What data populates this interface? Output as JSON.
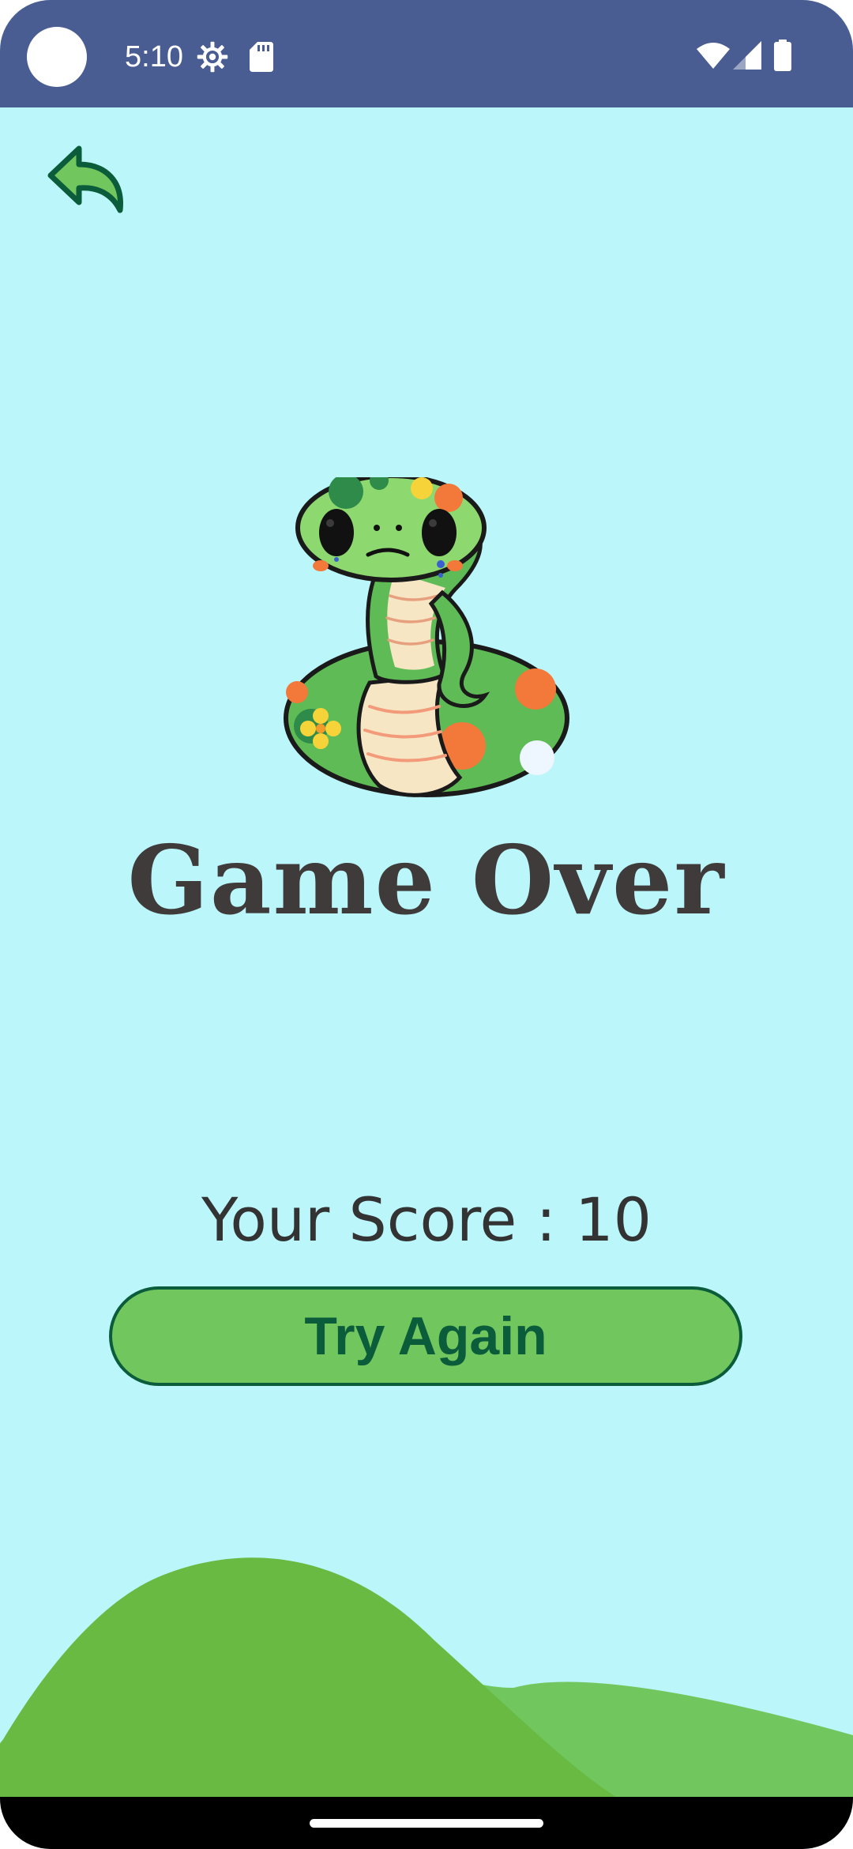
{
  "status_bar": {
    "time": "5:10",
    "background_color": "#4a5d93",
    "icons": [
      "settings-icon",
      "sd-card-icon",
      "wifi-icon",
      "cellular-signal-icon",
      "battery-icon"
    ]
  },
  "screen": {
    "background_color": "#bbf6fa",
    "back_icon": "back-reply-arrow-icon",
    "illustration": "sad-snake-illustration",
    "title": "Game Over",
    "score_text": "Your Score : 10",
    "try_again_label": "Try Again"
  },
  "colors": {
    "button_fill": "#72c65e",
    "button_border": "#0b5c3a",
    "hill_dark": "#69ba42",
    "hill_light": "#72c65e"
  },
  "nav_bar": {
    "home_indicator": "home-indicator"
  }
}
